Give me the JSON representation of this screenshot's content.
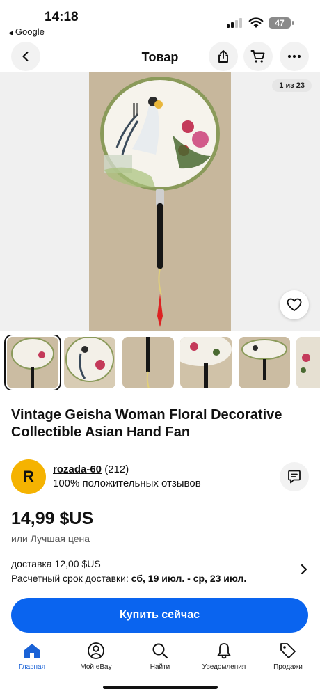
{
  "status_bar": {
    "time": "14:18",
    "back_app": "Google",
    "battery": "47"
  },
  "nav": {
    "title": "Товар"
  },
  "gallery": {
    "counter": "1 из 23"
  },
  "item": {
    "title": "Vintage Geisha Woman Floral Decorative Collectible Asian Hand Fan"
  },
  "seller": {
    "initial": "R",
    "name": "rozada-60",
    "rating_count": "(212)",
    "feedback": "100% положительных отзывов"
  },
  "price": {
    "amount": "14,99 $US",
    "best_offer": "или Лучшая цена"
  },
  "delivery": {
    "shipping": "доставка 12,00 $US",
    "eta_label": "Расчетный срок доставки:",
    "eta_value": "сб, 19 июл. - ср, 23 июл."
  },
  "buy_button": {
    "label": "Купить сейчас"
  },
  "tabbar": {
    "items": [
      {
        "label": "Главная",
        "icon": "home-icon"
      },
      {
        "label": "Мой eBay",
        "icon": "account-icon"
      },
      {
        "label": "Найти",
        "icon": "search-icon"
      },
      {
        "label": "Уведомления",
        "icon": "bell-icon"
      },
      {
        "label": "Продажи",
        "icon": "tag-icon"
      }
    ]
  },
  "colors": {
    "accent": "#0a64ef",
    "avatar": "#f5b301",
    "tab_active": "#1a62d6"
  }
}
